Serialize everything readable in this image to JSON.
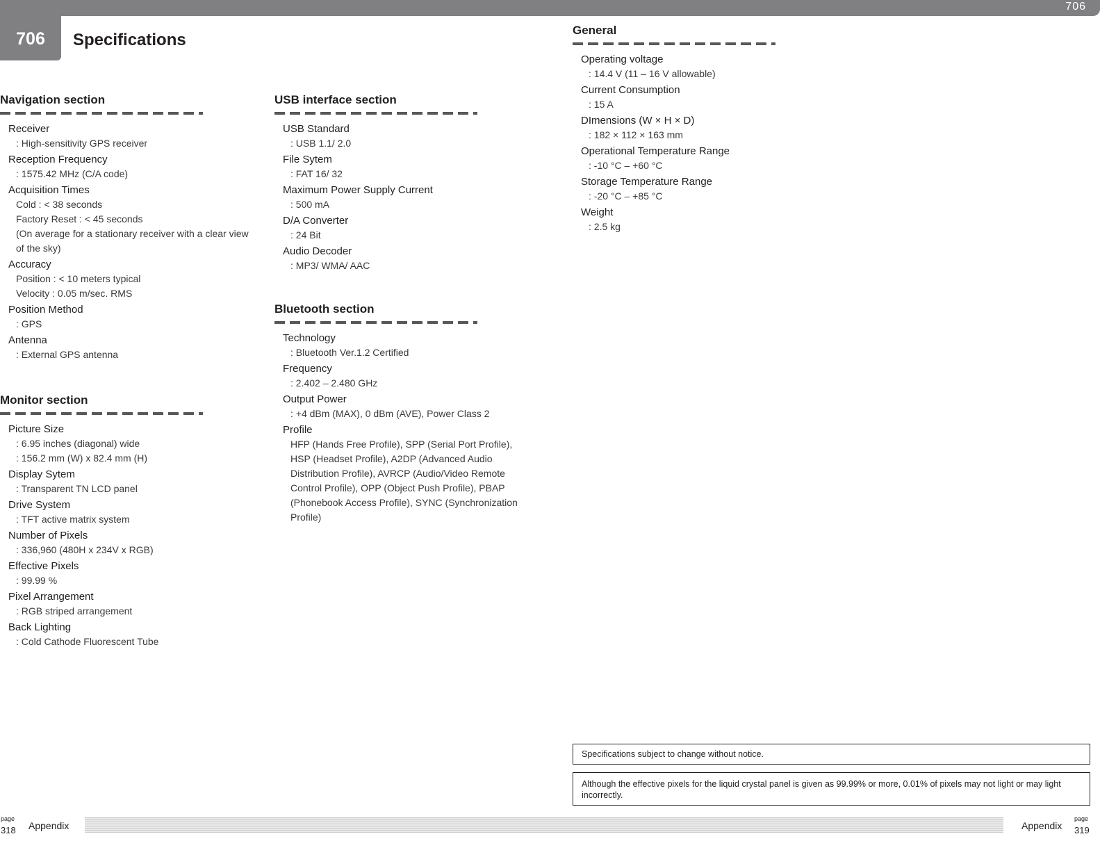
{
  "header": {
    "chapter_number": "706",
    "page_title": "Specifications",
    "top_bar_number": "706"
  },
  "colors": {
    "header_gray": "#808083",
    "dash_gray": "#58585a",
    "text": "#231f20"
  },
  "sections": {
    "navigation": {
      "title": "Navigation section",
      "items": [
        {
          "label": "Receiver",
          "values": [
            ": High-sensitivity GPS receiver"
          ]
        },
        {
          "label": "Reception Frequency",
          "values": [
            ": 1575.42 MHz (C/A code)"
          ]
        },
        {
          "label": "Acquisition Times",
          "values": [
            "Cold : < 38 seconds",
            "Factory Reset : < 45 seconds",
            "(On average for a stationary receiver with a clear view of the sky)"
          ]
        },
        {
          "label": "Accuracy",
          "values": [
            "Position : < 10 meters typical",
            "Velocity : 0.05 m/sec. RMS"
          ]
        },
        {
          "label": "Position Method",
          "values": [
            ": GPS"
          ]
        },
        {
          "label": "Antenna",
          "values": [
            ": External GPS antenna"
          ]
        }
      ]
    },
    "monitor": {
      "title": "Monitor section",
      "items": [
        {
          "label": "Picture Size",
          "values": [
            ": 6.95 inches (diagonal) wide",
            ": 156.2 mm (W) x 82.4 mm (H)"
          ]
        },
        {
          "label": "Display Sytem",
          "values": [
            ": Transparent TN LCD panel"
          ]
        },
        {
          "label": "Drive System",
          "values": [
            ": TFT active matrix system"
          ]
        },
        {
          "label": "Number of Pixels",
          "values": [
            ": 336,960 (480H x 234V x RGB)"
          ]
        },
        {
          "label": "Effective Pixels",
          "values": [
            ": 99.99 %"
          ]
        },
        {
          "label": "Pixel Arrangement",
          "values": [
            ": RGB striped arrangement"
          ]
        },
        {
          "label": "Back Lighting",
          "values": [
            ": Cold Cathode Fluorescent Tube"
          ]
        }
      ]
    },
    "usb": {
      "title": "USB interface section",
      "items": [
        {
          "label": "USB Standard",
          "values": [
            ": USB 1.1/ 2.0"
          ]
        },
        {
          "label": "File Sytem",
          "values": [
            ": FAT 16/ 32"
          ]
        },
        {
          "label": "Maximum Power Supply Current",
          "values": [
            ": 500 mA"
          ]
        },
        {
          "label": "D/A Converter",
          "values": [
            ": 24 Bit"
          ]
        },
        {
          "label": "Audio Decoder",
          "values": [
            ": MP3/ WMA/ AAC"
          ]
        }
      ]
    },
    "bluetooth": {
      "title": "Bluetooth section",
      "items": [
        {
          "label": "Technology",
          "values": [
            ": Bluetooth Ver.1.2 Certified"
          ]
        },
        {
          "label": "Frequency",
          "values": [
            ": 2.402 – 2.480 GHz"
          ]
        },
        {
          "label": "Output Power",
          "values": [
            ": +4 dBm (MAX), 0 dBm (AVE), Power Class 2"
          ]
        },
        {
          "label": "Profile",
          "values": [
            "HFP (Hands Free Profile), SPP (Serial Port Profile), HSP (Headset Profile), A2DP (Advanced Audio Distribution Profile), AVRCP (Audio/Video Remote Control Profile), OPP (Object Push Profile), PBAP (Phonebook Access Profile), SYNC (Synchronization Profile)"
          ]
        }
      ]
    },
    "general": {
      "title": "General",
      "items": [
        {
          "label": "Operating voltage",
          "values": [
            ": 14.4 V (11 – 16 V allowable)"
          ]
        },
        {
          "label": "Current Consumption",
          "values": [
            ": 15 A"
          ]
        },
        {
          "label": "DImensions  (W × H × D)",
          "values": [
            ": 182 × 112 × 163 mm"
          ]
        },
        {
          "label": "Operational Temperature Range",
          "values": [
            ": -10 °C – +60 °C"
          ]
        },
        {
          "label": "Storage Temperature Range",
          "values": [
            ": -20 °C – +85 °C"
          ]
        },
        {
          "label": "Weight",
          "values": [
            ": 2.5 kg"
          ]
        }
      ]
    }
  },
  "notices": {
    "change_notice": "Specifications subject to change without notice.",
    "pixel_notice": "Although the effective pixels for the liquid crystal panel is given as 99.99% or more, 0.01% of pixels may not light or may light incorrectly."
  },
  "footer": {
    "left": {
      "page_label": "page",
      "page_number": "318",
      "section": "Appendix"
    },
    "right": {
      "page_label": "page",
      "page_number": "319",
      "section": "Appendix"
    }
  }
}
